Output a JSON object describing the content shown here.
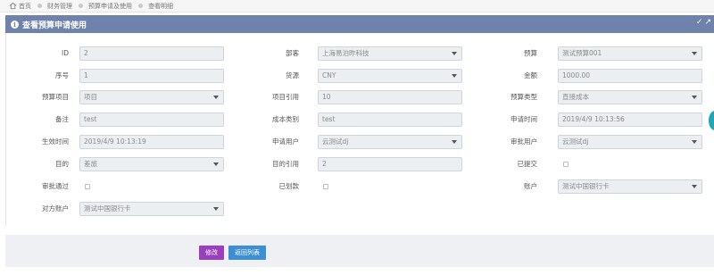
{
  "breadcrumb": [
    "首页",
    "财务管理",
    "预算申请及使用",
    "查看明细"
  ],
  "panel": {
    "title": "查看预算申请使用",
    "tools": "✓↗"
  },
  "fields": [
    {
      "label": "ID",
      "value": "2",
      "type": "text"
    },
    {
      "label": "部客",
      "value": "上海易泊昨科技",
      "type": "select"
    },
    {
      "label": "预算",
      "value": "测试预算001",
      "type": "select"
    },
    {
      "label": "序号",
      "value": "1",
      "type": "text"
    },
    {
      "label": "货源",
      "value": "CNY",
      "type": "select"
    },
    {
      "label": "金额",
      "value": "1000.00",
      "type": "text"
    },
    {
      "label": "预算项目",
      "value": "项目",
      "type": "select"
    },
    {
      "label": "项目引用",
      "value": "10",
      "type": "text"
    },
    {
      "label": "预算类型",
      "value": "直接成本",
      "type": "select"
    },
    {
      "label": "备注",
      "value": "test",
      "type": "text"
    },
    {
      "label": "成本类别",
      "value": "test",
      "type": "text"
    },
    {
      "label": "申请时间",
      "value": "2019/4/9 10:13:56",
      "type": "text"
    },
    {
      "label": "生效时间",
      "value": "2019/4/9 10:13:19",
      "type": "text"
    },
    {
      "label": "申请用户",
      "value": "云测试dj",
      "type": "select"
    },
    {
      "label": "审批用户",
      "value": "云测试dj",
      "type": "select"
    },
    {
      "label": "目的",
      "value": "差旅",
      "type": "select"
    },
    {
      "label": "目的引用",
      "value": "2",
      "type": "text"
    },
    {
      "label": "已提交",
      "value": "",
      "type": "checkbox"
    },
    {
      "label": "审批通过",
      "value": "",
      "type": "checkbox"
    },
    {
      "label": "已划款",
      "value": "",
      "type": "checkbox"
    },
    {
      "label": "账户",
      "value": "测试中国银行卡",
      "type": "select"
    },
    {
      "label": "对方账户",
      "value": "测试中国银行卡",
      "type": "select"
    }
  ],
  "buttons": {
    "edit": "修改",
    "back": "返回列表"
  }
}
